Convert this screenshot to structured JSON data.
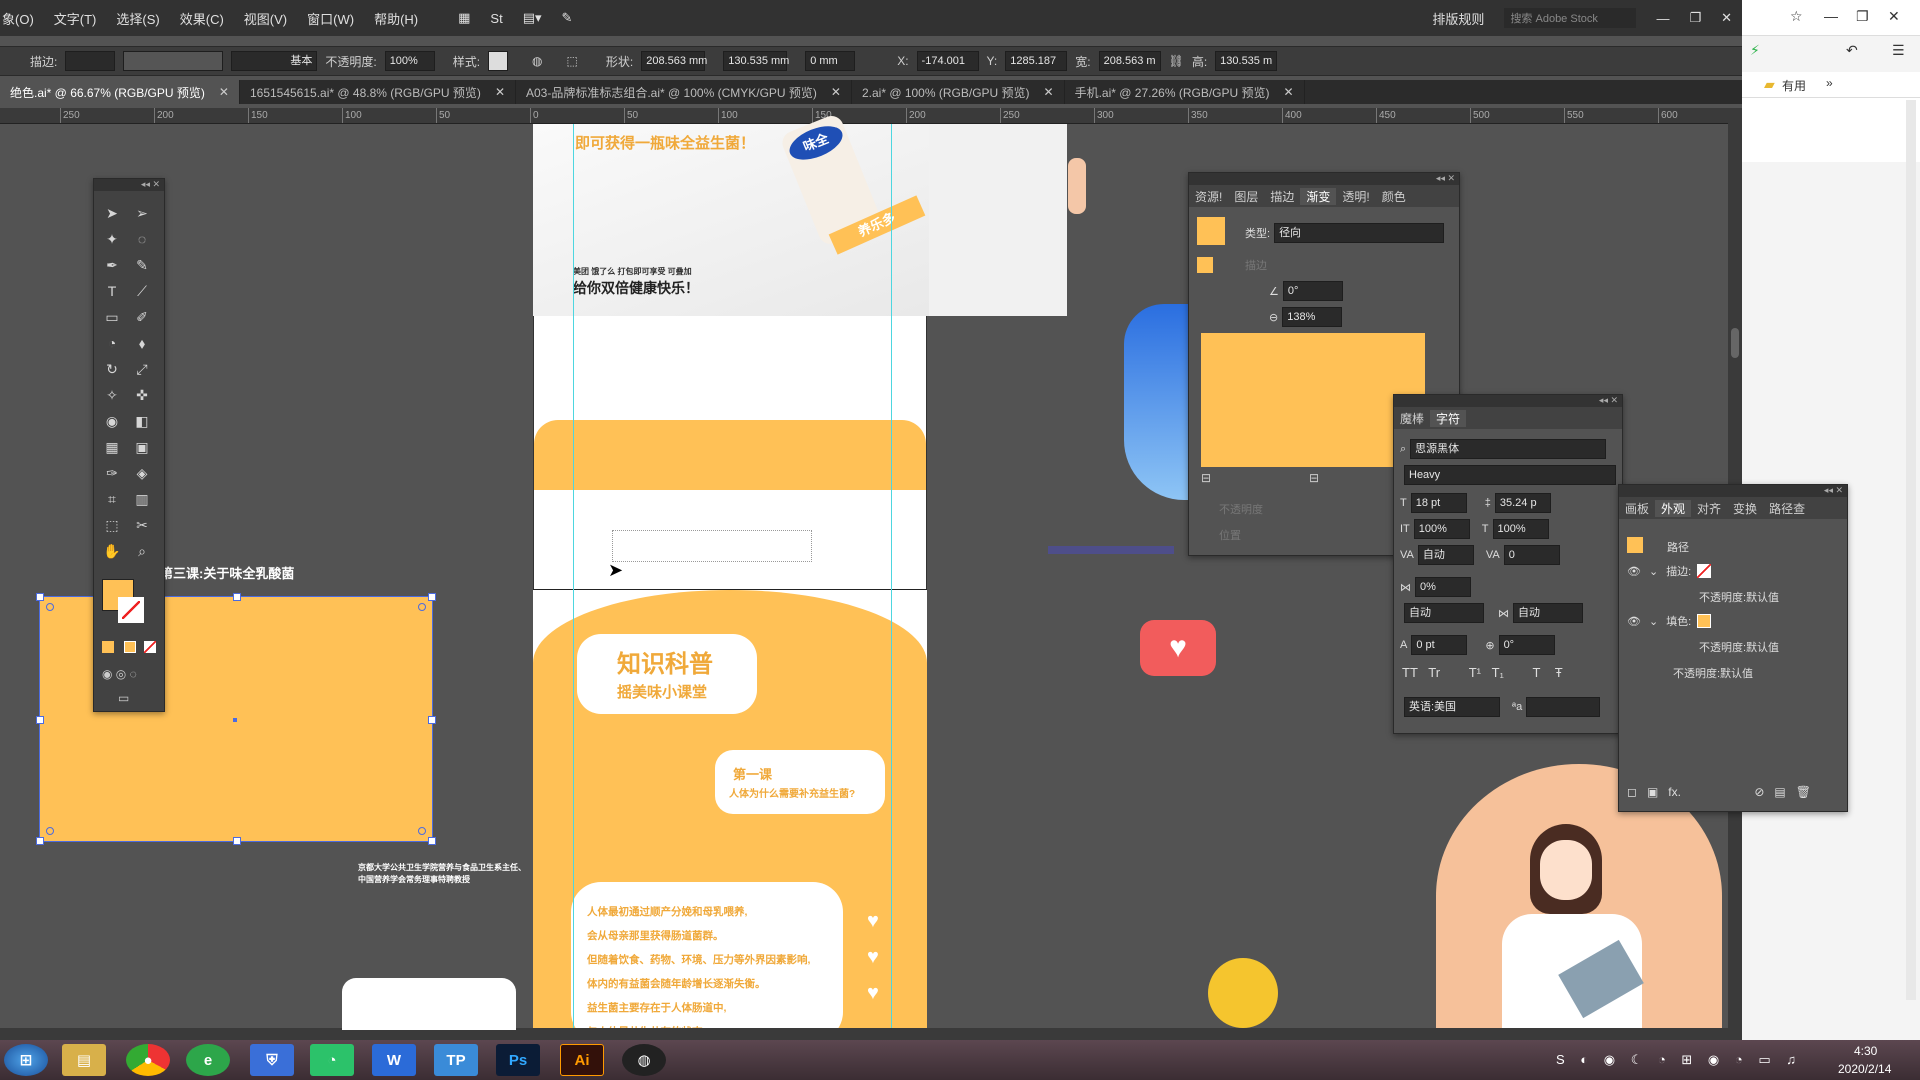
{
  "menubar": {
    "items": [
      "象(O)",
      "文字(T)",
      "选择(S)",
      "效果(C)",
      "视图(V)",
      "窗口(W)",
      "帮助(H)"
    ],
    "workspace": "排版规则",
    "stock_search": "搜索 Adobe Stock"
  },
  "controlbar": {
    "stroke_label": "描边:",
    "stroke_style": "基本",
    "opacity_label": "不透明度:",
    "opacity_value": "100%",
    "style_label": "样式:",
    "shape_label": "形状:",
    "shape_w": "208.563 mm",
    "shape_h": "130.535 mm",
    "corner": "0 mm",
    "x_label": "X:",
    "x_value": "-174.001",
    "y_label": "Y:",
    "y_value": "1285.187",
    "w_label": "宽:",
    "w_value": "208.563 m",
    "h_label": "高:",
    "h_value": "130.535 m"
  },
  "tabs": [
    {
      "label": "绝色.ai* @ 66.67% (RGB/GPU 预览)",
      "active": true
    },
    {
      "label": "1651545615.ai* @ 48.8% (RGB/GPU 预览)"
    },
    {
      "label": "A03-品牌标准标志组合.ai* @ 100% (CMYK/GPU 预览)"
    },
    {
      "label": "2.ai* @ 100% (RGB/GPU 预览)"
    },
    {
      "label": "手机.ai* @ 27.26% (RGB/GPU 预览)"
    }
  ],
  "ruler": [
    "250",
    "200",
    "150",
    "100",
    "50",
    "0",
    "50",
    "100",
    "150",
    "200",
    "250",
    "300",
    "350",
    "400",
    "450",
    "500",
    "550",
    "600"
  ],
  "browser": {
    "bookmark": "有用"
  },
  "artboard": {
    "top_text": "即可获得一瓶味全益生菌！",
    "bottle_label": "味全",
    "ribbon": "养乐多",
    "small_line": "美团 饿了么 打包即可享受 可叠加",
    "happy_line": "给你双倍健康快乐！",
    "science_title": "知识科普",
    "science_sub": "摇美味小课堂",
    "lesson_title": "第一课",
    "lesson_sub": "人体为什么需要补充益生菌?",
    "body_lines": [
      "人体最初通过顺产分娩和母乳喂养,",
      "会从母亲那里获得肠道菌群。",
      "但随着饮食、药物、环境、压力等外界因素影响,",
      "体内的有益菌会随年龄增长逐渐失衡。",
      "益生菌主要存在于人体肠道中,",
      "与人体是共生共存的状态。"
    ]
  },
  "left_art": {
    "lesson3": "第三课:关于味全乳酸菌",
    "caption1": "京都大学公共卫生学院营养与食品卫生系主任、",
    "caption2": "中国营养学会常务理事特聘教授"
  },
  "gradient_panel": {
    "tabs": [
      "资源!",
      "图层",
      "描边",
      "渐变",
      "透明!",
      "颜色"
    ],
    "type_label": "类型:",
    "type_value": "径向",
    "stroke_label": "描边",
    "angle": "0°",
    "ratio": "138%",
    "opacity_label": "不透明度",
    "position_label": "位置",
    "color": "#ffc156"
  },
  "char_panel": {
    "tabs": [
      "魔棒",
      "字符"
    ],
    "font": "思源黑体",
    "weight": "Heavy",
    "size": "18 pt",
    "leading": "35.24 p",
    "h_scale": "100%",
    "v_scale": "100%",
    "kerning": "自动",
    "tracking": "0",
    "baseline": "0%",
    "auto1": "自动",
    "auto2": "自动",
    "shift": "0 pt",
    "rotate": "0°",
    "lang": "英语:美国"
  },
  "appearance_panel": {
    "tabs": [
      "画板",
      "外观",
      "对齐",
      "变换",
      "路径查"
    ],
    "path": "路径",
    "stroke_label": "描边:",
    "opacity1": "不透明度:默认值",
    "fill_label": "填色:",
    "opacity2": "不透明度:默认值",
    "opacity3": "不透明度:默认值"
  },
  "taskbar": {
    "time": "4:30",
    "date": "2020/2/14",
    "apps": [
      "Ps",
      "Ai"
    ]
  }
}
